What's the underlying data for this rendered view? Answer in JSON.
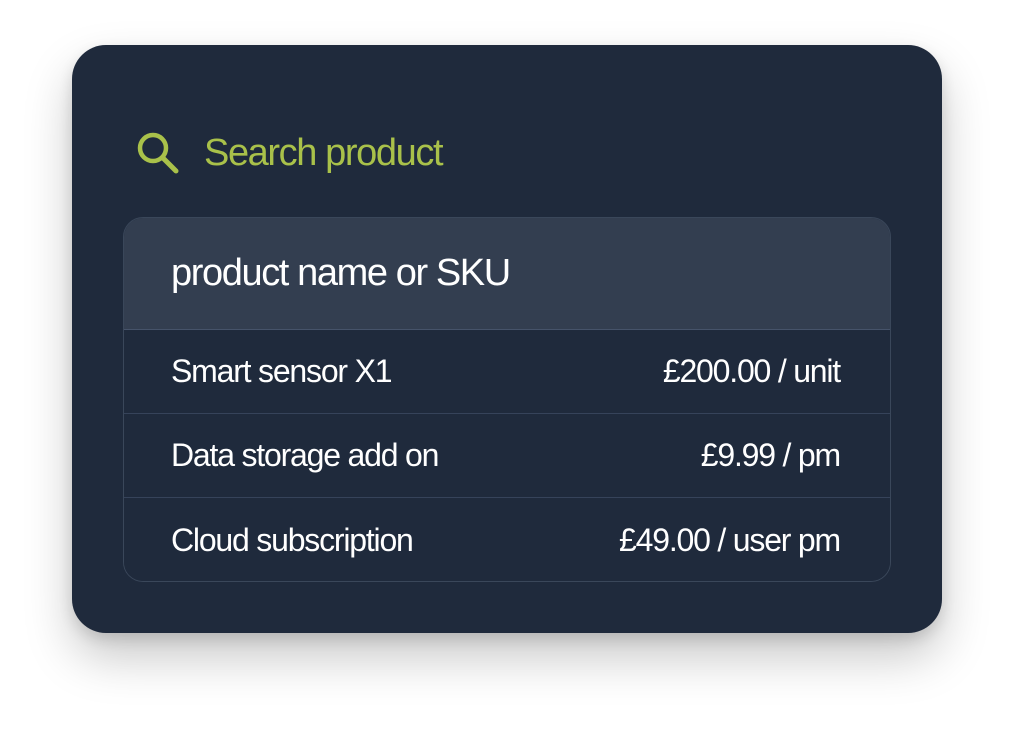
{
  "search": {
    "title": "Search product",
    "icon": "search-icon",
    "placeholder": "product name or SKU",
    "accent_color": "#a9c14a"
  },
  "results": [
    {
      "name": "Smart sensor X1",
      "price": "£200.00 / unit"
    },
    {
      "name": "Data storage add on",
      "price": "£9.99 / pm"
    },
    {
      "name": "Cloud subscription",
      "price": "£49.00 / user pm"
    }
  ]
}
